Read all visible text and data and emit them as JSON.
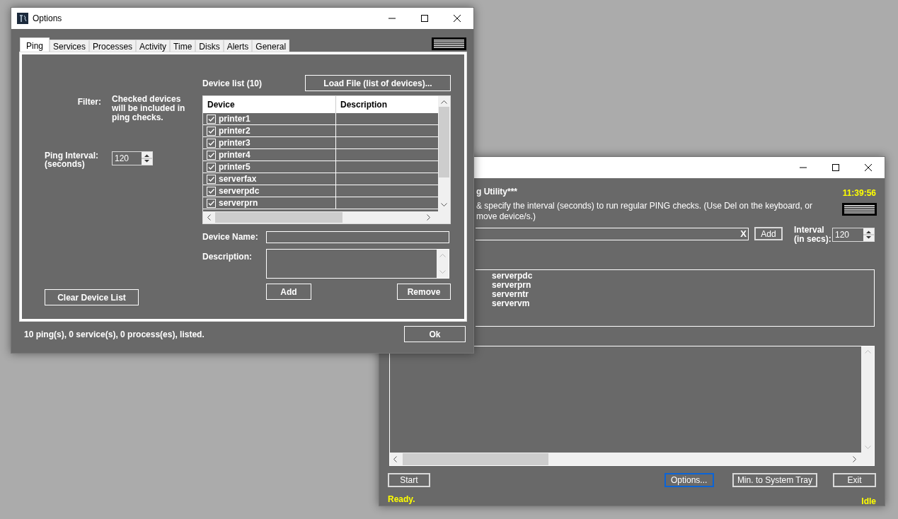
{
  "main_window": {
    "heading": "g Utility***",
    "clock": "11:39:56",
    "instructions": [
      "& specify the interval (seconds) to run regular PING checks. (Use Del on the keyboard, or",
      "move device/s.)"
    ],
    "entry": {
      "clear": "X"
    },
    "add_button": "Add",
    "interval_label": [
      "Interval",
      "(in secs):"
    ],
    "interval_value": "120",
    "devices": [
      "serverpdc",
      "serverprn",
      "serverntr",
      "servervm"
    ],
    "buttons": [
      {
        "label": "Start",
        "focused": false
      },
      {
        "label": "Options...",
        "focused": true
      },
      {
        "label": "Min. to System Tray",
        "focused": false
      },
      {
        "label": "Exit",
        "focused": false
      }
    ],
    "status": "Ready.",
    "state": "Idle"
  },
  "options_window": {
    "title": "Options",
    "tabs": [
      {
        "label": "Ping",
        "selected": true
      },
      {
        "label": "Services",
        "selected": false
      },
      {
        "label": "Processes",
        "selected": false
      },
      {
        "label": "Activity",
        "selected": false
      },
      {
        "label": "Time",
        "selected": false
      },
      {
        "label": "Disks",
        "selected": false
      },
      {
        "label": "Alerts",
        "selected": false
      },
      {
        "label": "General",
        "selected": false
      }
    ],
    "filter_label": "Filter:",
    "filter_note": "Checked devices will be included in ping checks.",
    "ping_interval_label": [
      "Ping Interval:",
      "(seconds)"
    ],
    "ping_interval_value": "120",
    "device_list_label": "Device list (10)",
    "load_button": "Load File (list of devices)...",
    "grid": {
      "columns": [
        "Device",
        "Description"
      ],
      "rows": [
        {
          "device": "printer1",
          "checked": true
        },
        {
          "device": "printer2",
          "checked": true
        },
        {
          "device": "printer3",
          "checked": true
        },
        {
          "device": "printer4",
          "checked": true
        },
        {
          "device": "printer5",
          "checked": true
        },
        {
          "device": "serverfax",
          "checked": true
        },
        {
          "device": "serverpdc",
          "checked": true
        },
        {
          "device": "serverprn",
          "checked": true
        }
      ]
    },
    "device_name_label": "Device Name:",
    "description_label": "Description:",
    "clear_button": "Clear Device List",
    "add_button": "Add",
    "remove_button": "Remove",
    "status": "10 ping(s), 0 service(s), 0 process(es), listed.",
    "ok_button": "Ok"
  }
}
